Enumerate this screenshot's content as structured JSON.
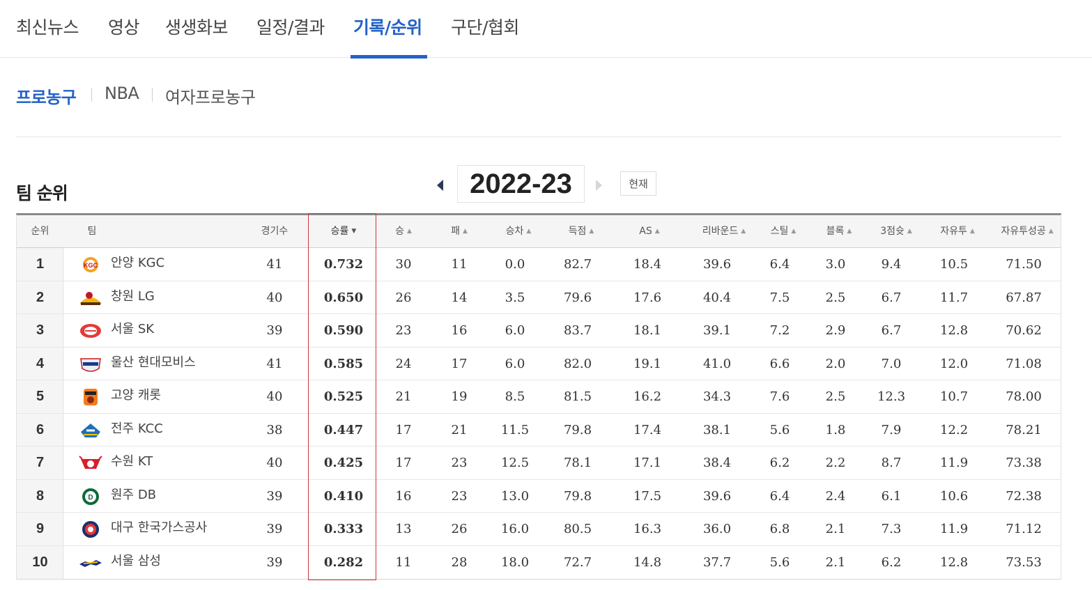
{
  "top_tabs": [
    "최신뉴스",
    "영상",
    "생생화보",
    "일정/결과",
    "기록/순위",
    "구단/협회"
  ],
  "active_top_tab": "기록/순위",
  "sub_tabs": [
    "프로농구",
    "NBA",
    "여자프로농구"
  ],
  "active_sub_tab": "프로농구",
  "title": "팀 순위",
  "season": "2022-23",
  "now_button": "현재",
  "columns": [
    "순위",
    "팀",
    "경기수",
    "승률",
    "승",
    "패",
    "승차",
    "득점",
    "AS",
    "리바운드",
    "스틸",
    "블록",
    "3점슛",
    "자유투",
    "자유투성공"
  ],
  "sorted_column": "승률",
  "colors": {
    "accent": "#2362c7",
    "highlight_border": "#c9363b"
  },
  "rows": [
    {
      "rank": "1",
      "team": "안양 KGC",
      "logo": "kgc-logo-icon",
      "games": "41",
      "pct": "0.732",
      "w": "30",
      "l": "11",
      "gb": "0.0",
      "pts": "82.7",
      "as": "18.4",
      "reb": "39.6",
      "stl": "6.4",
      "blk": "3.0",
      "tp": "9.4",
      "ft": "10.5",
      "ftp": "71.50"
    },
    {
      "rank": "2",
      "team": "창원 LG",
      "logo": "lg-logo-icon",
      "games": "40",
      "pct": "0.650",
      "w": "26",
      "l": "14",
      "gb": "3.5",
      "pts": "79.6",
      "as": "17.6",
      "reb": "40.4",
      "stl": "7.5",
      "blk": "2.5",
      "tp": "6.7",
      "ft": "11.7",
      "ftp": "67.87"
    },
    {
      "rank": "3",
      "team": "서울 SK",
      "logo": "sk-logo-icon",
      "games": "39",
      "pct": "0.590",
      "w": "23",
      "l": "16",
      "gb": "6.0",
      "pts": "83.7",
      "as": "18.1",
      "reb": "39.1",
      "stl": "7.2",
      "blk": "2.9",
      "tp": "6.7",
      "ft": "12.8",
      "ftp": "70.62"
    },
    {
      "rank": "4",
      "team": "울산 현대모비스",
      "logo": "mobis-logo-icon",
      "games": "41",
      "pct": "0.585",
      "w": "24",
      "l": "17",
      "gb": "6.0",
      "pts": "82.0",
      "as": "19.1",
      "reb": "41.0",
      "stl": "6.6",
      "blk": "2.0",
      "tp": "7.0",
      "ft": "12.0",
      "ftp": "71.08"
    },
    {
      "rank": "5",
      "team": "고양 캐롯",
      "logo": "carrot-logo-icon",
      "games": "40",
      "pct": "0.525",
      "w": "21",
      "l": "19",
      "gb": "8.5",
      "pts": "81.5",
      "as": "16.2",
      "reb": "34.3",
      "stl": "7.6",
      "blk": "2.5",
      "tp": "12.3",
      "ft": "10.7",
      "ftp": "78.00"
    },
    {
      "rank": "6",
      "team": "전주 KCC",
      "logo": "kcc-logo-icon",
      "games": "38",
      "pct": "0.447",
      "w": "17",
      "l": "21",
      "gb": "11.5",
      "pts": "79.8",
      "as": "17.4",
      "reb": "38.1",
      "stl": "5.6",
      "blk": "1.8",
      "tp": "7.9",
      "ft": "12.2",
      "ftp": "78.21"
    },
    {
      "rank": "7",
      "team": "수원 KT",
      "logo": "kt-logo-icon",
      "games": "40",
      "pct": "0.425",
      "w": "17",
      "l": "23",
      "gb": "12.5",
      "pts": "78.1",
      "as": "17.1",
      "reb": "38.4",
      "stl": "6.2",
      "blk": "2.2",
      "tp": "8.7",
      "ft": "11.9",
      "ftp": "73.38"
    },
    {
      "rank": "8",
      "team": "원주 DB",
      "logo": "db-logo-icon",
      "games": "39",
      "pct": "0.410",
      "w": "16",
      "l": "23",
      "gb": "13.0",
      "pts": "79.8",
      "as": "17.5",
      "reb": "39.6",
      "stl": "6.4",
      "blk": "2.4",
      "tp": "6.1",
      "ft": "10.6",
      "ftp": "72.38"
    },
    {
      "rank": "9",
      "team": "대구 한국가스공사",
      "logo": "kogas-logo-icon",
      "games": "39",
      "pct": "0.333",
      "w": "13",
      "l": "26",
      "gb": "16.0",
      "pts": "80.5",
      "as": "16.3",
      "reb": "36.0",
      "stl": "6.8",
      "blk": "2.1",
      "tp": "7.3",
      "ft": "11.9",
      "ftp": "71.12"
    },
    {
      "rank": "10",
      "team": "서울 삼성",
      "logo": "samsung-logo-icon",
      "games": "39",
      "pct": "0.282",
      "w": "11",
      "l": "28",
      "gb": "18.0",
      "pts": "72.7",
      "as": "14.8",
      "reb": "37.7",
      "stl": "5.6",
      "blk": "2.1",
      "tp": "6.2",
      "ft": "12.8",
      "ftp": "73.53"
    }
  ]
}
